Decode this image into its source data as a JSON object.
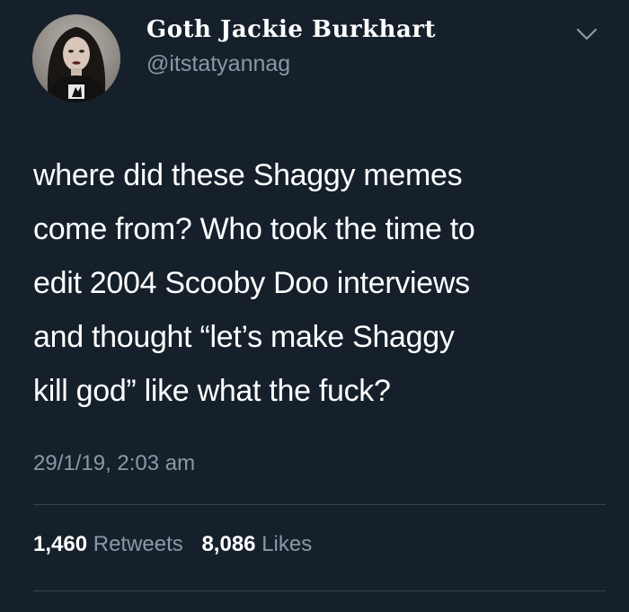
{
  "user": {
    "display_name": "Goth Jackie Burkhart",
    "handle": "@itstatyannag"
  },
  "tweet": {
    "text": "where did these Shaggy memes\ncome from? Who took the time to\nedit 2004 Scooby Doo interviews\nand thought “let’s make Shaggy\nkill god” like what the fuck?",
    "timestamp": "29/1/19, 2:03 am"
  },
  "stats": {
    "retweets_count": "1,460",
    "retweets_label": "Retweets",
    "likes_count": "8,086",
    "likes_label": "Likes"
  },
  "icons": {
    "menu": "chevron-down-icon"
  },
  "colors": {
    "background": "#15202b",
    "text": "#ffffff",
    "secondary_text": "#8899a6",
    "divider": "#38444d"
  }
}
